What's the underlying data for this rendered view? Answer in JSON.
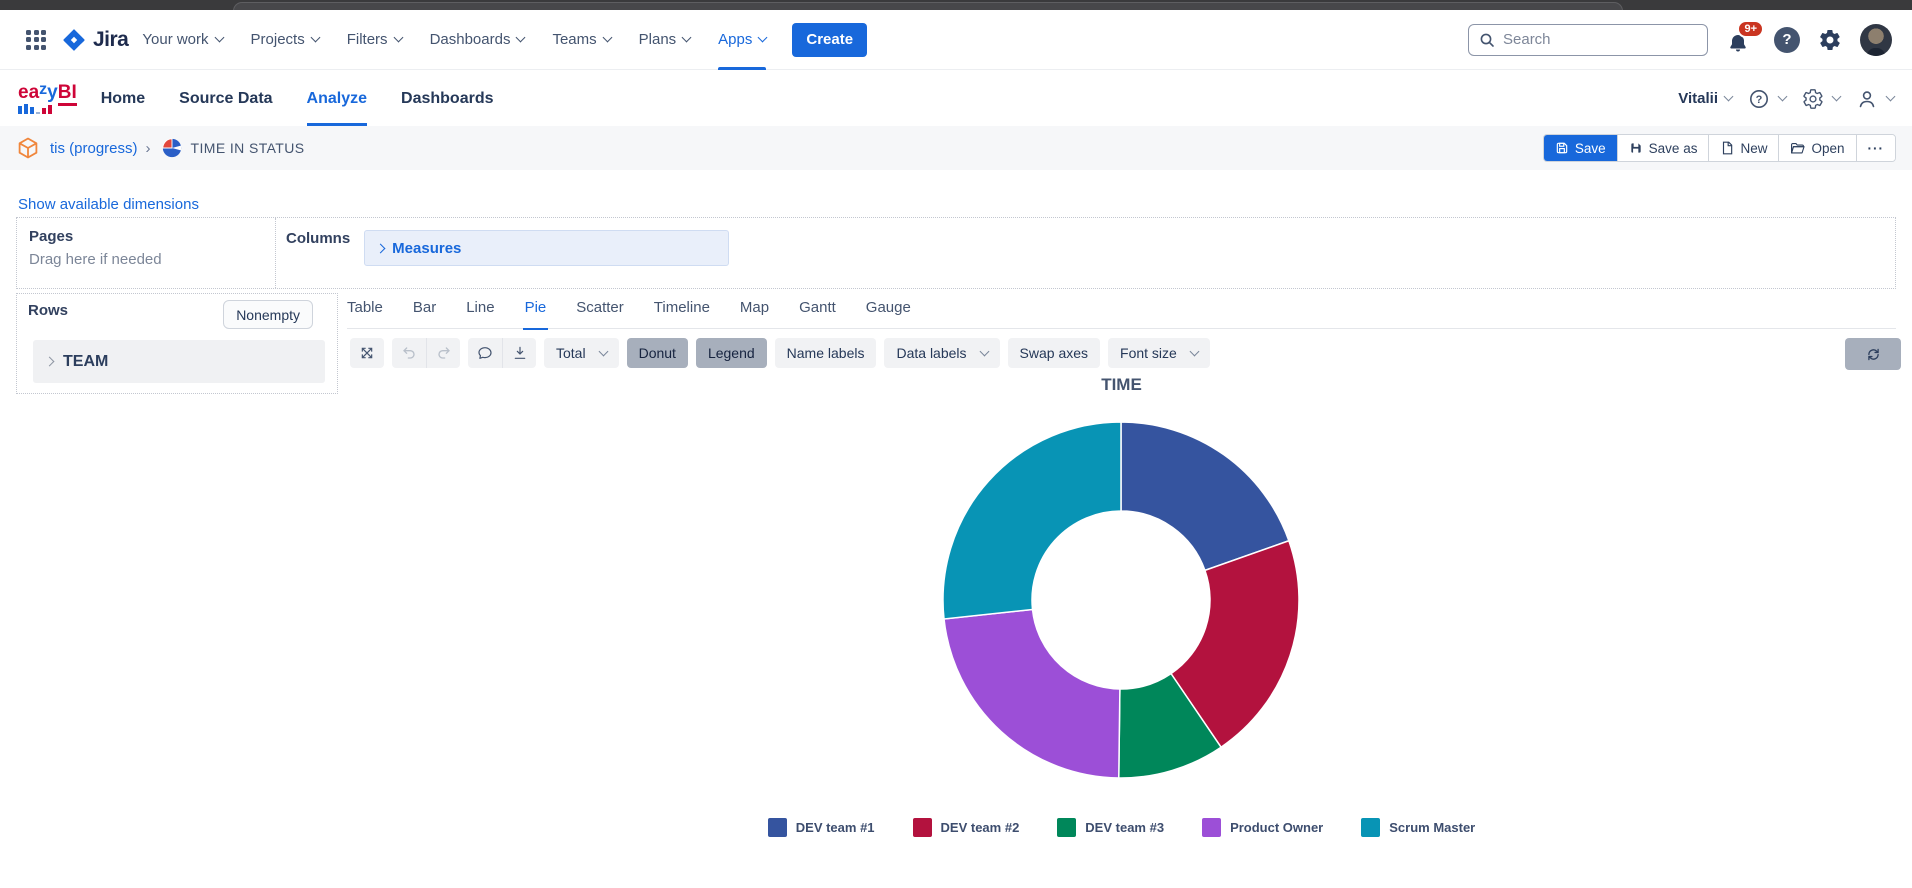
{
  "jira_nav": {
    "menu": [
      "Your work",
      "Projects",
      "Filters",
      "Dashboards",
      "Teams",
      "Plans",
      "Apps"
    ],
    "active_item": "Apps",
    "logo_text": "Jira",
    "create_label": "Create",
    "search_placeholder": "Search",
    "notification_badge": "9+",
    "help_glyph": "?"
  },
  "eazybi_nav": {
    "logo_ea": "ea",
    "logo_z": "z",
    "logo_y": "y",
    "logo_bi": "BI",
    "menu": [
      "Home",
      "Source Data",
      "Analyze",
      "Dashboards"
    ],
    "active_item": "Analyze",
    "user_name": "Vitalii"
  },
  "report_bar": {
    "account_link": "tis (progress)",
    "separator": "›",
    "report_title": "TIME IN STATUS",
    "save_label": "Save",
    "save_as_label": "Save as",
    "new_label": "New",
    "open_label": "Open",
    "more_label": "···"
  },
  "builder": {
    "show_dimensions_link": "Show available dimensions",
    "pages_label": "Pages",
    "pages_hint": "Drag here if needed",
    "columns_label": "Columns",
    "columns_member": "Measures",
    "rows_label": "Rows",
    "nonempty_label": "Nonempty",
    "rows_member": "TEAM"
  },
  "view_tabs": {
    "tabs": [
      "Table",
      "Bar",
      "Line",
      "Pie",
      "Scatter",
      "Timeline",
      "Map",
      "Gantt",
      "Gauge"
    ],
    "active_tab": "Pie"
  },
  "toolbar": {
    "total_label": "Total",
    "donut_label": "Donut",
    "legend_label": "Legend",
    "name_labels_label": "Name labels",
    "data_labels_label": "Data labels",
    "swap_axes_label": "Swap axes",
    "font_size_label": "Font size",
    "active_toggles": [
      "Donut",
      "Legend"
    ]
  },
  "colors": {
    "accent_blue": "#1868db",
    "badge_red": "#ca3521",
    "logo_red": "#ce0538"
  },
  "chart_data": {
    "type": "pie",
    "donut": true,
    "title": "TIME",
    "categories": [
      "DEV team #1",
      "DEV team #2",
      "DEV team #3",
      "Product Owner",
      "Scrum Master"
    ],
    "values": [
      19.6,
      20.9,
      9.7,
      23.1,
      26.7
    ],
    "unit": "percent-of-circle",
    "colors": [
      "#35549f",
      "#b3123e",
      "#00875a",
      "#9c4fd7",
      "#0894b5"
    ],
    "legend_position": "bottom",
    "inner_radius_ratio": 0.5
  }
}
